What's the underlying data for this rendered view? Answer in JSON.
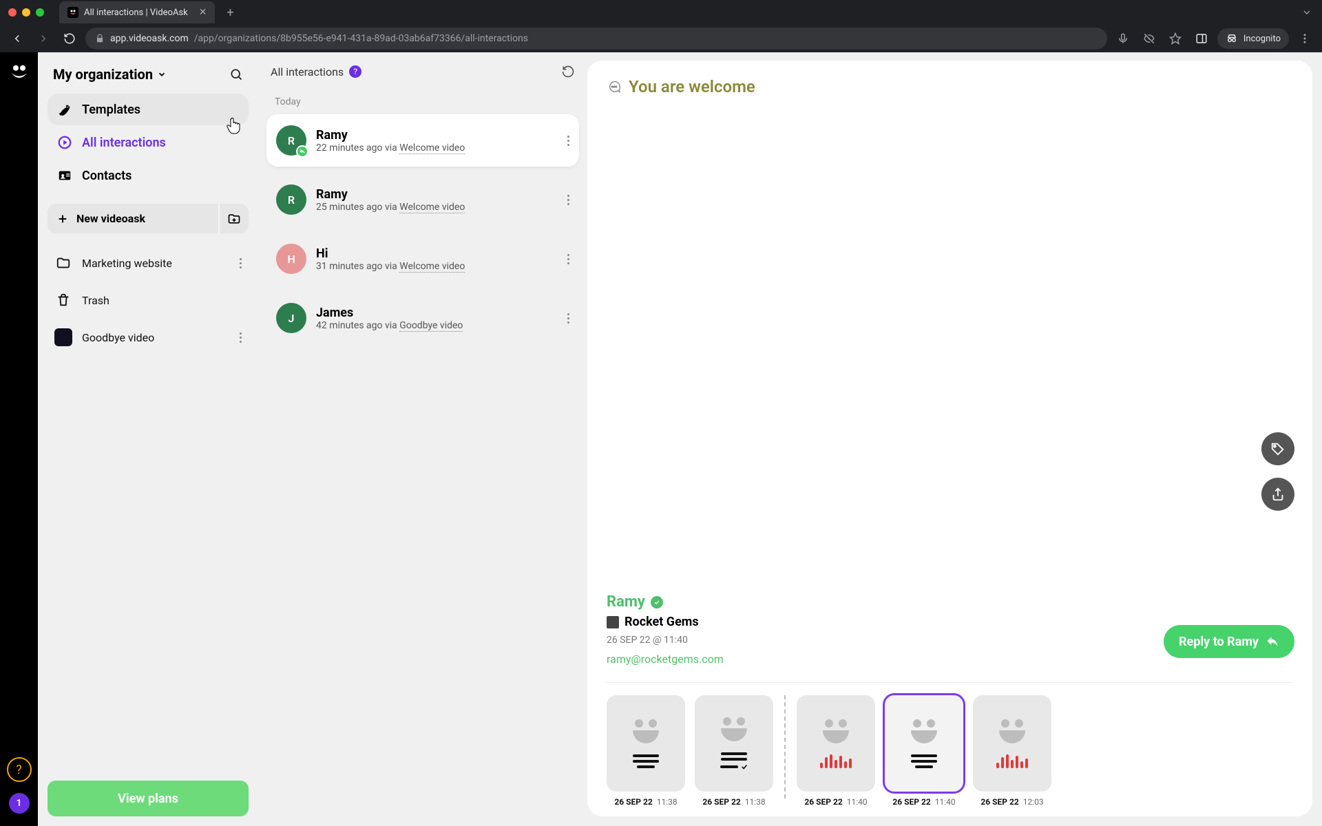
{
  "browser": {
    "tab_title": "All interactions | VideoAsk",
    "url_host": "app.videoask.com",
    "url_path": "/app/organizations/8b955e56-e941-431a-89ad-03ab6af73366/all-interactions",
    "incognito_label": "Incognito"
  },
  "sidebar": {
    "org_name": "My organization",
    "nav": {
      "templates": "Templates",
      "all_interactions": "All interactions",
      "contacts": "Contacts"
    },
    "new_button": "New videoask",
    "folders": {
      "marketing": "Marketing website",
      "trash": "Trash",
      "goodbye": "Goodbye video"
    },
    "view_plans": "View plans",
    "notif_count": "1"
  },
  "midcol": {
    "title": "All interactions",
    "group_today": "Today",
    "items": [
      {
        "initial": "R",
        "name": "Ramy",
        "time": "22 minutes ago",
        "via": "via",
        "link": "Welcome video"
      },
      {
        "initial": "R",
        "name": "Ramy",
        "time": "25 minutes ago",
        "via": "via",
        "link": "Welcome video"
      },
      {
        "initial": "H",
        "name": "Hi",
        "time": "31 minutes ago",
        "via": "via",
        "link": "Welcome video"
      },
      {
        "initial": "J",
        "name": "James",
        "time": "42 minutes ago",
        "via": "via",
        "link": "Goodbye video"
      }
    ]
  },
  "detail": {
    "title": "You are welcome",
    "profile_name": "Ramy",
    "company": "Rocket Gems",
    "timestamp": "26 SEP 22 @ 11:40",
    "email": "ramy@rocketgems.com",
    "reply_label": "Reply to Ramy",
    "thumbs": [
      {
        "date": "26 SEP 22",
        "time": "11:38",
        "kind": "text"
      },
      {
        "date": "26 SEP 22",
        "time": "11:38",
        "kind": "textcheck"
      },
      {
        "date": "26 SEP 22",
        "time": "11:40",
        "kind": "audio"
      },
      {
        "date": "26 SEP 22",
        "time": "11:40",
        "kind": "text",
        "selected": true
      },
      {
        "date": "26 SEP 22",
        "time": "12:03",
        "kind": "audio"
      }
    ]
  }
}
